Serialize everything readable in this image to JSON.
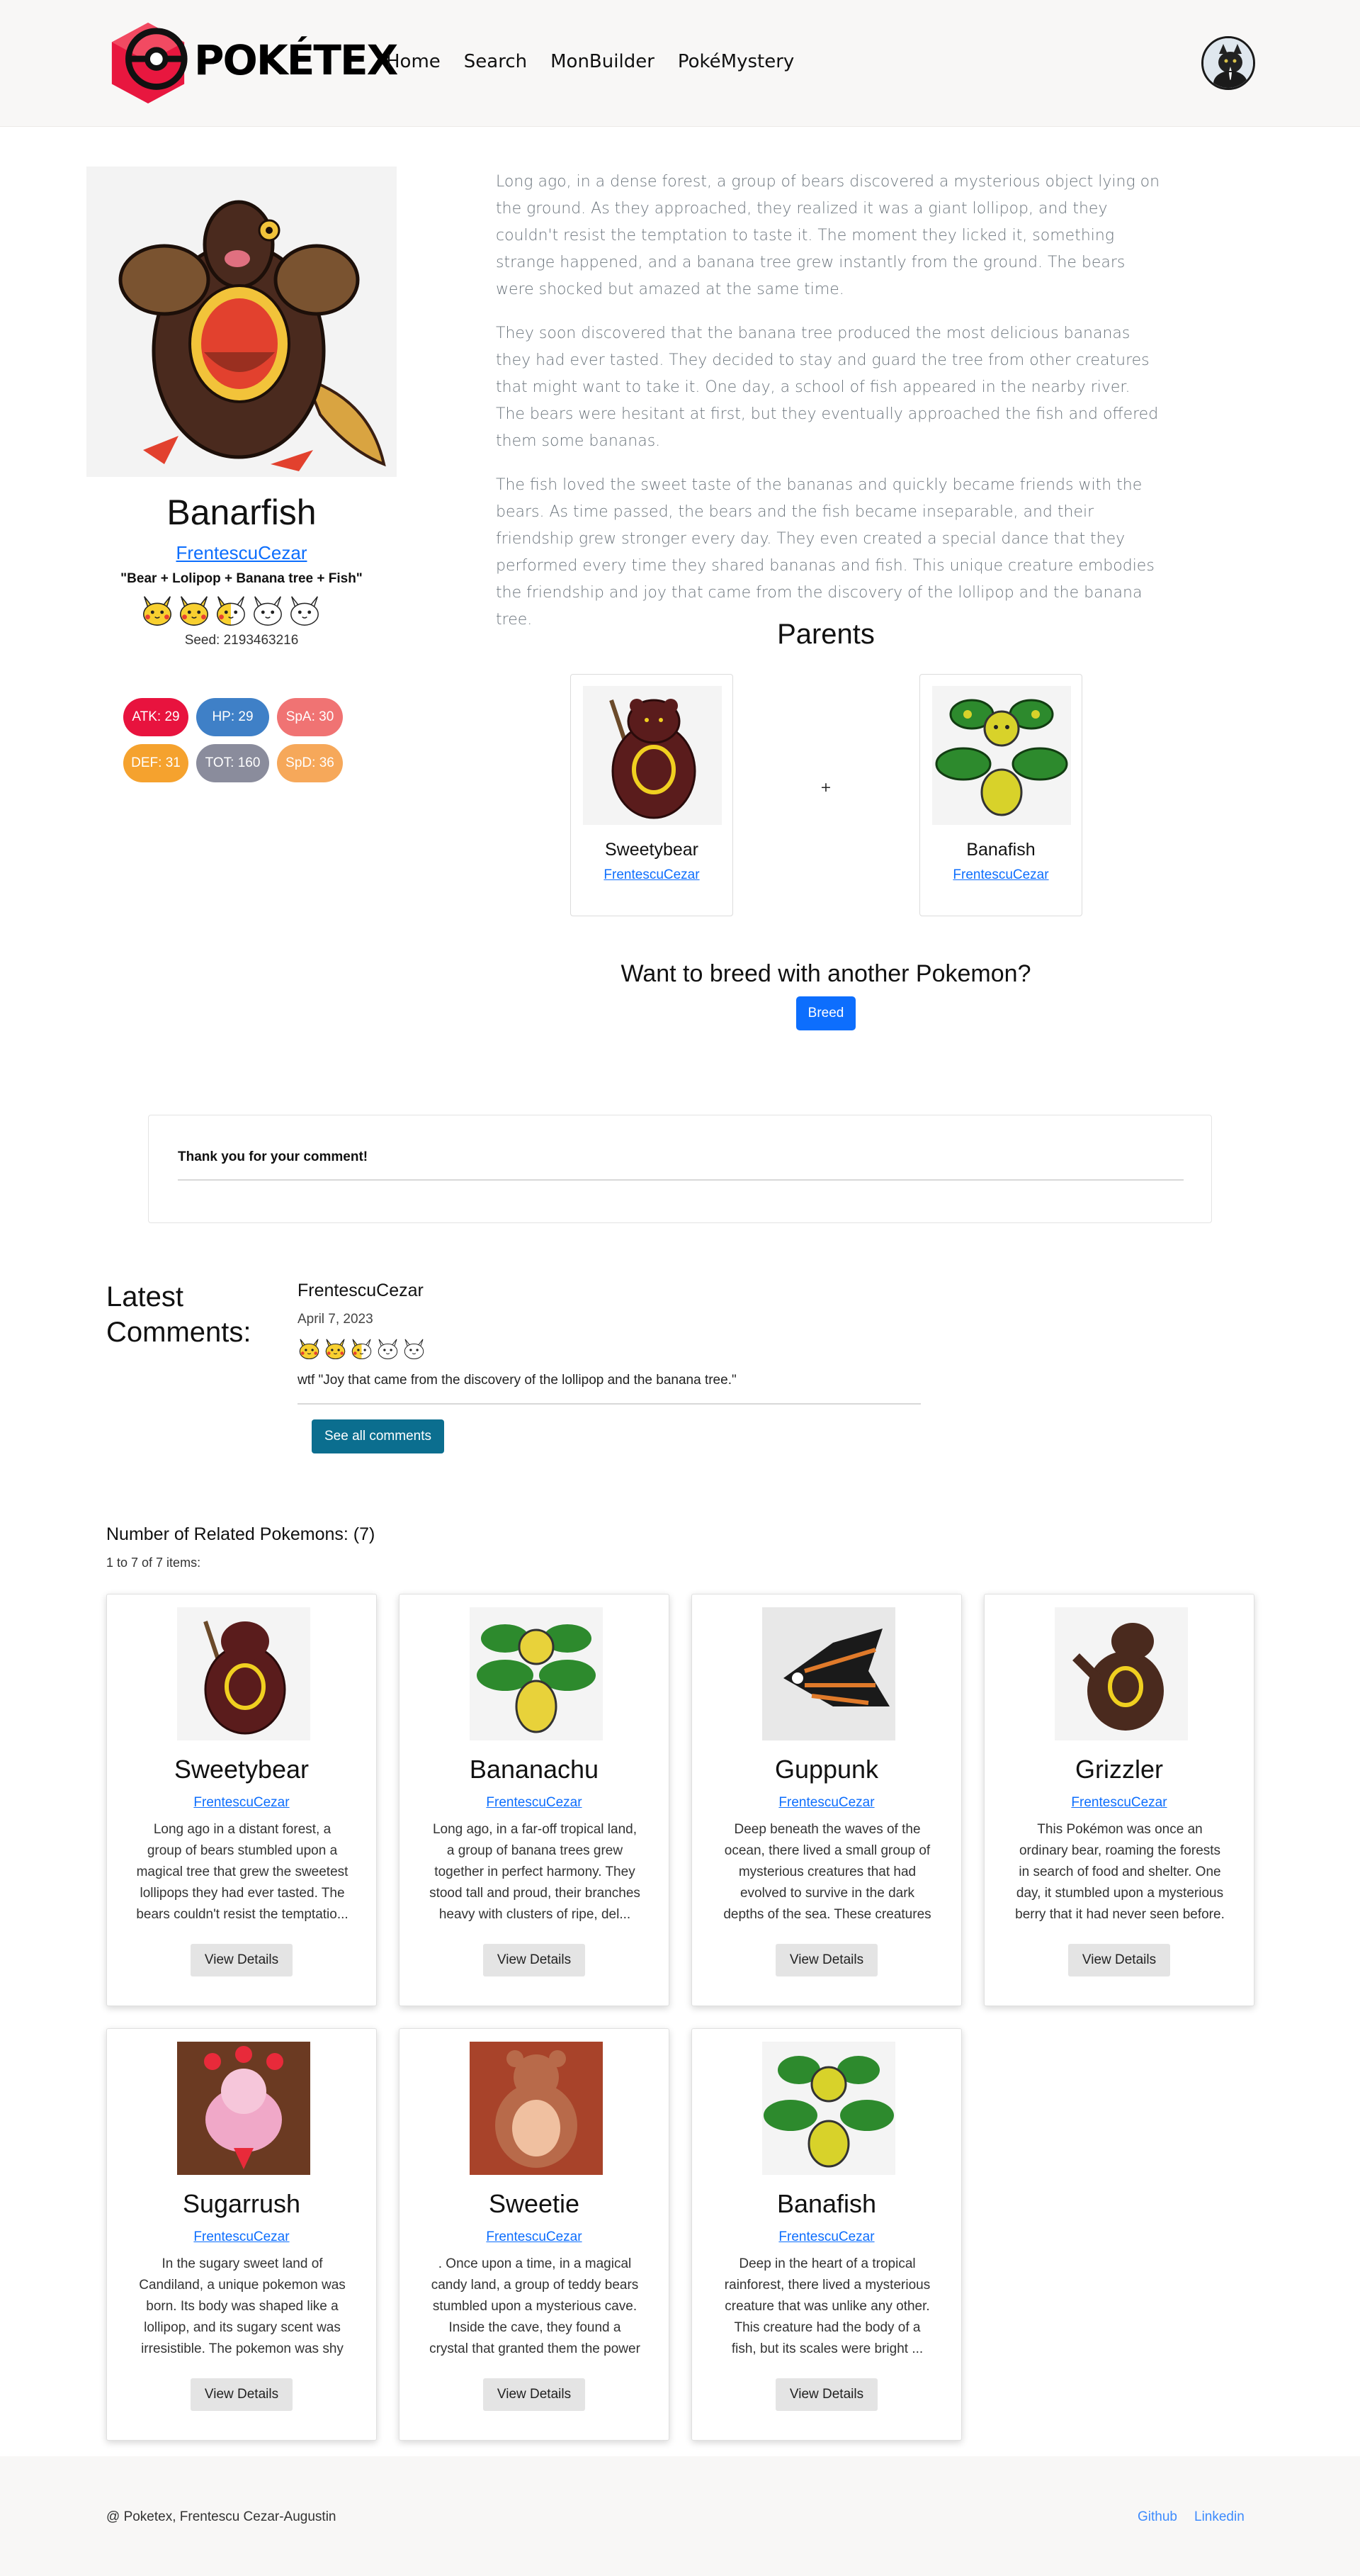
{
  "brand": {
    "name": "POKÉTEX"
  },
  "nav": {
    "items": [
      "Home",
      "Search",
      "MonBuilder",
      "PokéMystery"
    ]
  },
  "pokemon": {
    "name": "Banarfish",
    "author": "FrentescuCezar",
    "recipe": "\"Bear + Lolipop + Banana tree + Fish\"",
    "rating_value": 2.5,
    "rating_max": 5,
    "seed": "Seed: 2193463216",
    "stats": [
      {
        "label": "ATK: 29",
        "color": "#e8133e"
      },
      {
        "label": "HP: 29",
        "color": "#3f80c7"
      },
      {
        "label": "SpA: 30",
        "color": "#f07373"
      },
      {
        "label": "DEF: 31",
        "color": "#f5a22e"
      },
      {
        "label": "TOT: 160",
        "color": "#8a8c9c"
      },
      {
        "label": "SpD: 36",
        "color": "#f6a85a"
      }
    ]
  },
  "story": [
    "Long ago, in a dense forest, a group of bears discovered a mysterious object lying on the ground. As they approached, they realized it was a giant lollipop, and they couldn't resist the temptation to taste it. The moment they licked it, something strange happened, and a banana tree grew instantly from the ground. The bears were shocked but amazed at the same time.",
    "They soon discovered that the banana tree produced the most delicious bananas they had ever tasted. They decided to stay and guard the tree from other creatures that might want to take it. One day, a school of fish appeared in the nearby river. The bears were hesitant at first, but they eventually approached the fish and offered them some bananas.",
    "The fish loved the sweet taste of the bananas and quickly became friends with the bears. As time passed, the bears and the fish became inseparable, and their friendship grew stronger every day. They even created a special dance that they performed every time they shared bananas and fish. This unique creature embodies the friendship and joy that came from the discovery of the lollipop and the banana tree."
  ],
  "parents": {
    "title": "Parents",
    "separator": "+",
    "items": [
      {
        "name": "Sweetybear",
        "author": "FrentescuCezar"
      },
      {
        "name": "Banafish",
        "author": "FrentescuCezar"
      }
    ]
  },
  "breed": {
    "title": "Want to breed with another Pokemon?",
    "button": "Breed"
  },
  "comment_box": {
    "message": "Thank you for your comment!"
  },
  "latest_comments": {
    "title_line1": "Latest",
    "title_line2": "Comments:",
    "items": [
      {
        "author": "FrentescuCezar",
        "date": "April 7, 2023",
        "rating_value": 2.5,
        "text": "wtf \"Joy that came from the discovery of the lollipop and the banana tree.\""
      }
    ],
    "see_all": "See all comments"
  },
  "related": {
    "title": "Number of Related Pokemons: (7)",
    "items_line": "1 to 7 of 7 items:",
    "button_label": "View Details",
    "cards": [
      {
        "name": "Sweetybear",
        "author": "FrentescuCezar",
        "desc": "Long ago in a distant forest, a group of bears stumbled upon a magical tree that grew the sweetest lollipops they had ever tasted. The bears couldn't resist the temptatio..."
      },
      {
        "name": "Bananachu",
        "author": "FrentescuCezar",
        "desc": "Long ago, in a far-off tropical land, a group of banana trees grew together in perfect harmony. They stood tall and proud, their branches heavy with clusters of ripe, del..."
      },
      {
        "name": "Guppunk",
        "author": "FrentescuCezar",
        "desc": "Deep beneath the waves of the ocean, there lived a small group of mysterious creatures that had evolved to survive in the dark depths of the sea. These creatures were unl..."
      },
      {
        "name": "Grizzler",
        "author": "FrentescuCezar",
        "desc": "This Pokémon was once an ordinary bear, roaming the forests in search of food and shelter. One day, it stumbled upon a mysterious berry that it had never seen before. The..."
      },
      {
        "name": "Sugarrush",
        "author": "FrentescuCezar",
        "desc": "In the sugary sweet land of Candiland, a unique pokemon was born. Its body was shaped like a lollipop, and its sugary scent was irresistible. The pokemon was shy and ofte..."
      },
      {
        "name": "Sweetie",
        "author": "FrentescuCezar",
        "desc": ". Once upon a time, in a magical candy land, a group of teddy bears stumbled upon a mysterious cave. Inside the cave, they found a crystal that granted them the power to..."
      },
      {
        "name": "Banafish",
        "author": "FrentescuCezar",
        "desc": "Deep in the heart of a tropical rainforest, there lived a mysterious creature that was unlike any other. This creature had the body of a fish, but its scales were bright ..."
      }
    ]
  },
  "footer": {
    "copyright": "@ Poketex, Frentescu Cezar-Augustin",
    "links": [
      "Github",
      "Linkedin"
    ]
  }
}
